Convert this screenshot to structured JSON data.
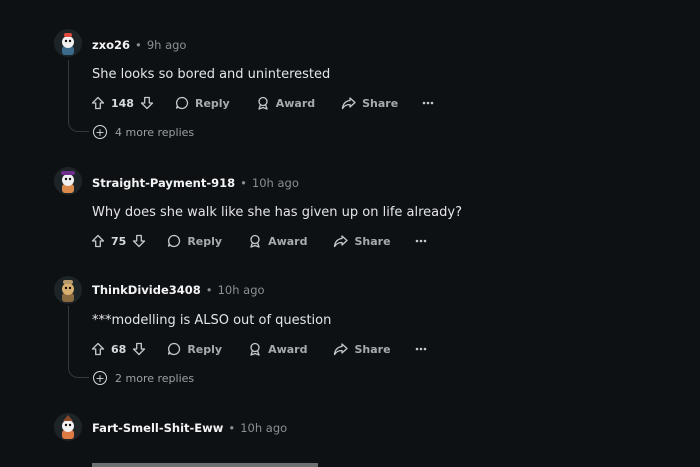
{
  "comments": [
    {
      "username": "zxo26",
      "time": "9h ago",
      "text": "She looks so bored and uninterested",
      "votes": "148",
      "reply": "Reply",
      "award": "Award",
      "share": "Share",
      "more_replies": "4 more replies",
      "avatar_colors": {
        "bg": "#3b6a8a",
        "accent": "#e04a3f"
      }
    },
    {
      "username": "Straight-Payment-918",
      "time": "10h ago",
      "text": "Why does she walk like she has given up on life already?",
      "votes": "75",
      "reply": "Reply",
      "award": "Award",
      "share": "Share",
      "avatar_colors": {
        "bg": "#6b2f8a",
        "accent": "#d88b4a"
      }
    },
    {
      "username": "ThinkDivide3408",
      "time": "10h ago",
      "text": "***modelling is ALSO out of question",
      "votes": "68",
      "reply": "Reply",
      "award": "Award",
      "share": "Share",
      "more_replies": "2 more replies",
      "avatar_colors": {
        "bg": "#8a6a3f",
        "accent": "#d9b070"
      }
    },
    {
      "username": "Fart-Smell-Shit-Eww",
      "time": "10h ago",
      "avatar_colors": {
        "bg": "#8a4a2a",
        "accent": "#e07a45"
      }
    }
  ],
  "separator": "•",
  "more_glyph": "+"
}
